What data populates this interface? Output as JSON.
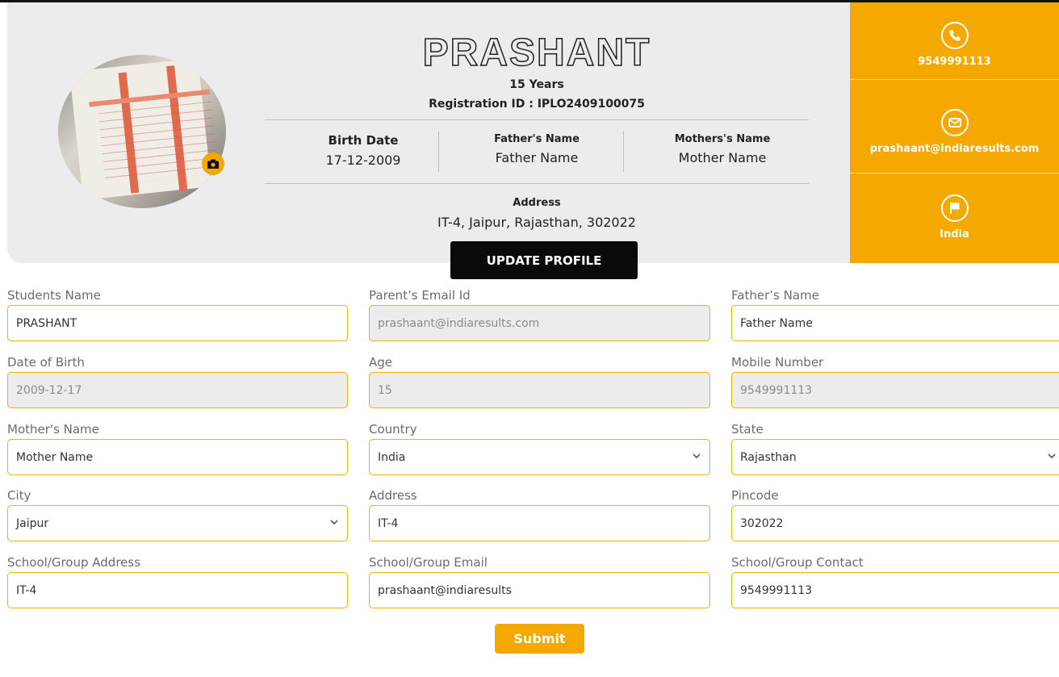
{
  "profile": {
    "name": "PRASHANT",
    "age": "15 Years",
    "registration": "Registration ID : IPLO2409100075",
    "birth_label": "Birth Date",
    "birth_value": "17-12-2009",
    "father_label": "Father's Name",
    "father_value": "Father Name",
    "mother_label": "Mothers's Name",
    "mother_value": "Mother Name",
    "address_label": "Address",
    "address_value": "IT-4, Jaipur, Rajasthan, 302022",
    "update_label": "UPDATE PROFILE"
  },
  "contact": {
    "phone": "9549991113",
    "email": "prashaant@indiaresults.com",
    "country": "India",
    "icons": [
      "phone-icon",
      "mail-icon",
      "flag-icon"
    ]
  },
  "form": {
    "fields": [
      {
        "label": "Students Name",
        "value": "PRASHANT"
      },
      {
        "label": "Parent’s Email Id",
        "value": "prashaant@indiaresults.com"
      },
      {
        "label": "Father’s Name",
        "value": "Father Name"
      },
      {
        "label": "Date of Birth",
        "value": "2009-12-17"
      },
      {
        "label": "Age",
        "value": "15"
      },
      {
        "label": "Mobile Number",
        "value": "9549991113"
      },
      {
        "label": "Mother's Name",
        "value": "Mother Name"
      },
      {
        "label": "Country",
        "value": "India"
      },
      {
        "label": "State",
        "value": "Rajasthan"
      },
      {
        "label": "City",
        "value": "Jaipur"
      },
      {
        "label": "Address",
        "value": "IT-4"
      },
      {
        "label": "Pincode",
        "value": "302022"
      },
      {
        "label": "School/Group Address",
        "value": "IT-4"
      },
      {
        "label": "School/Group Email",
        "value": "prashaant@indiaresults"
      },
      {
        "label": "School/Group Contact",
        "value": "9549991113"
      }
    ],
    "submit_label": "Submit"
  },
  "colors": {
    "accent": "#f4a800",
    "card": "#ececee",
    "button_dark": "#0a0a0a"
  }
}
